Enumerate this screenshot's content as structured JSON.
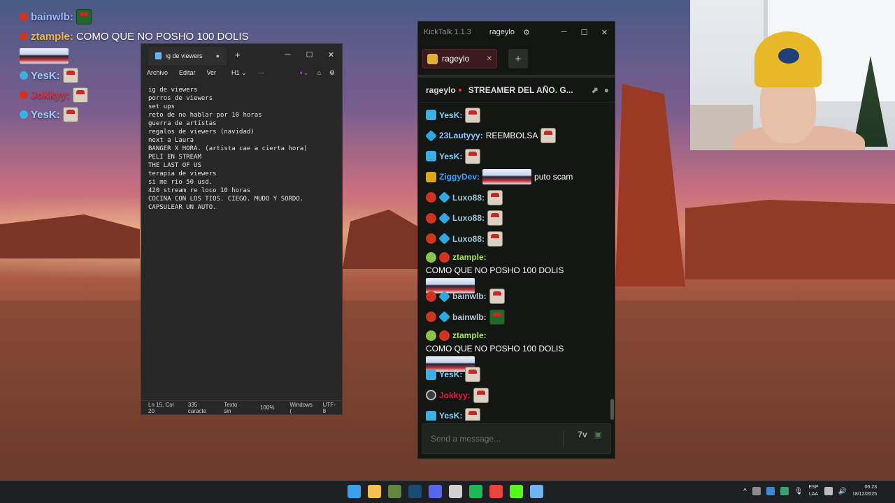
{
  "overlay_chat": [
    {
      "user": "bainwlb",
      "user_color": "#9ab8ff",
      "text": "",
      "emote": "green"
    },
    {
      "user": "ztample",
      "user_color": "#f0b84a",
      "text": "COMO QUE NO POSHO 100 DOLIS",
      "emote": ""
    },
    {
      "user": "",
      "user_color": "#ffffff",
      "text": "",
      "emote": "image"
    },
    {
      "user": "YesK",
      "user_color": "#9ad0ff",
      "text": "",
      "emote": "pixel"
    },
    {
      "user": "Jokkyy",
      "user_color": "#e03040",
      "text": "",
      "emote": "pixel"
    },
    {
      "user": "YesK",
      "user_color": "#9ad0ff",
      "text": "",
      "emote": "pixel"
    }
  ],
  "notepad": {
    "tab_title": "ig de viewers",
    "menu": [
      "Archivo",
      "Editar",
      "Ver"
    ],
    "heading_select": "H1",
    "lines": [
      "ig de viewers",
      "porros de viewers",
      "set ups",
      "reto de no hablar por 10 horas",
      "guerra de artistas",
      "regalos de viewers (navidad)",
      "next a Laura",
      "BANGER X HORA. (artista cae a cierta hora)",
      "PELI EN STREAM",
      "THE LAST OF US",
      "terapia de viewers",
      "si me rio 50 usd.",
      "420 stream re loco 10 horas",
      "COCINA CON LOS TIOS. CIEGO. MUDO Y SORDO.",
      "CAPSULEAR UN AUTO."
    ],
    "status": {
      "position": "Ln 15, Col 20",
      "chars": "335 caracte",
      "format": "Texto sin",
      "zoom": "100%",
      "eol": "Windows (",
      "encoding": "UTF-8"
    }
  },
  "kicktalk": {
    "app_title": "KickTalk 1.1.3",
    "title_channel": "rageylo",
    "tab_label": "rageylo",
    "stream_channel": "rageylo",
    "stream_title": "STREAMER DEL AÑO. G...",
    "input_placeholder": "Send a message...",
    "messages": [
      {
        "badges": [
          "blue"
        ],
        "user": "YesK:",
        "user_color": "#7fd4ff",
        "text": "",
        "emote": "pixel",
        "tall": false
      },
      {
        "badges": [
          "cube"
        ],
        "user": "23Lautyyy:",
        "user_color": "#8ec9ff",
        "text": "REEMBOLSA",
        "emote": "pixel",
        "tall": false
      },
      {
        "badges": [
          "blue"
        ],
        "user": "YesK:",
        "user_color": "#7fd4ff",
        "text": "",
        "emote": "pixel",
        "tall": false
      },
      {
        "badges": [
          "gold"
        ],
        "user": "ZiggyDev:",
        "user_color": "#3aa0ff",
        "text": "puto scam",
        "emote": "image",
        "tall": false
      },
      {
        "badges": [
          "red",
          "cube"
        ],
        "user": "Luxo88:",
        "user_color": "#9ec4d8",
        "text": "",
        "emote": "pixel",
        "tall": false
      },
      {
        "badges": [
          "red",
          "cube"
        ],
        "user": "Luxo88:",
        "user_color": "#9ec4d8",
        "text": "",
        "emote": "pixel",
        "tall": false
      },
      {
        "badges": [
          "red",
          "cube"
        ],
        "user": "Luxo88:",
        "user_color": "#9ec4d8",
        "text": "",
        "emote": "pixel",
        "tall": false
      },
      {
        "badges": [
          "green",
          "red"
        ],
        "user": "ztample:",
        "user_color": "#a8e05a",
        "text": "COMO QUE NO POSHO 100 DOLIS",
        "emote": "image",
        "tall": true
      },
      {
        "badges": [
          "red",
          "cube"
        ],
        "user": "bainwlb:",
        "user_color": "#b7c9d8",
        "text": "",
        "emote": "pixel",
        "tall": false
      },
      {
        "badges": [
          "red",
          "cube"
        ],
        "user": "bainwlb:",
        "user_color": "#b7c9d8",
        "text": "",
        "emote": "green",
        "tall": false
      },
      {
        "badges": [
          "green",
          "red"
        ],
        "user": "ztample:",
        "user_color": "#a8e05a",
        "text": "COMO QUE NO POSHO 100 DOLIS",
        "emote": "image",
        "tall": true
      },
      {
        "badges": [
          "blue"
        ],
        "user": "YesK:",
        "user_color": "#7fd4ff",
        "text": "",
        "emote": "pixel",
        "tall": false
      },
      {
        "badges": [
          "dark"
        ],
        "user": "Jokkyy:",
        "user_color": "#e0203a",
        "text": "",
        "emote": "pixel",
        "tall": false
      },
      {
        "badges": [
          "blue"
        ],
        "user": "YesK:",
        "user_color": "#7fd4ff",
        "text": "",
        "emote": "pixel",
        "tall": false
      }
    ]
  },
  "taskbar": {
    "apps": [
      {
        "name": "windows-start-icon",
        "color": "#3aa0f0"
      },
      {
        "name": "file-explorer-icon",
        "color": "#f2c14e"
      },
      {
        "name": "minecraft-icon",
        "color": "#5c8a3a"
      },
      {
        "name": "steam-icon",
        "color": "#1b4a73"
      },
      {
        "name": "discord-icon",
        "color": "#5865f2"
      },
      {
        "name": "obs-icon",
        "color": "#d0d0d0"
      },
      {
        "name": "spotify-icon",
        "color": "#1db954"
      },
      {
        "name": "chrome-icon",
        "color": "#e8453c"
      },
      {
        "name": "kick-icon",
        "color": "#53fc18"
      },
      {
        "name": "notepad-icon",
        "color": "#6cb4f0"
      }
    ],
    "lang_top": "ESP",
    "lang_bottom": "LAA",
    "time": "06:23",
    "date": "18/12/2025"
  }
}
